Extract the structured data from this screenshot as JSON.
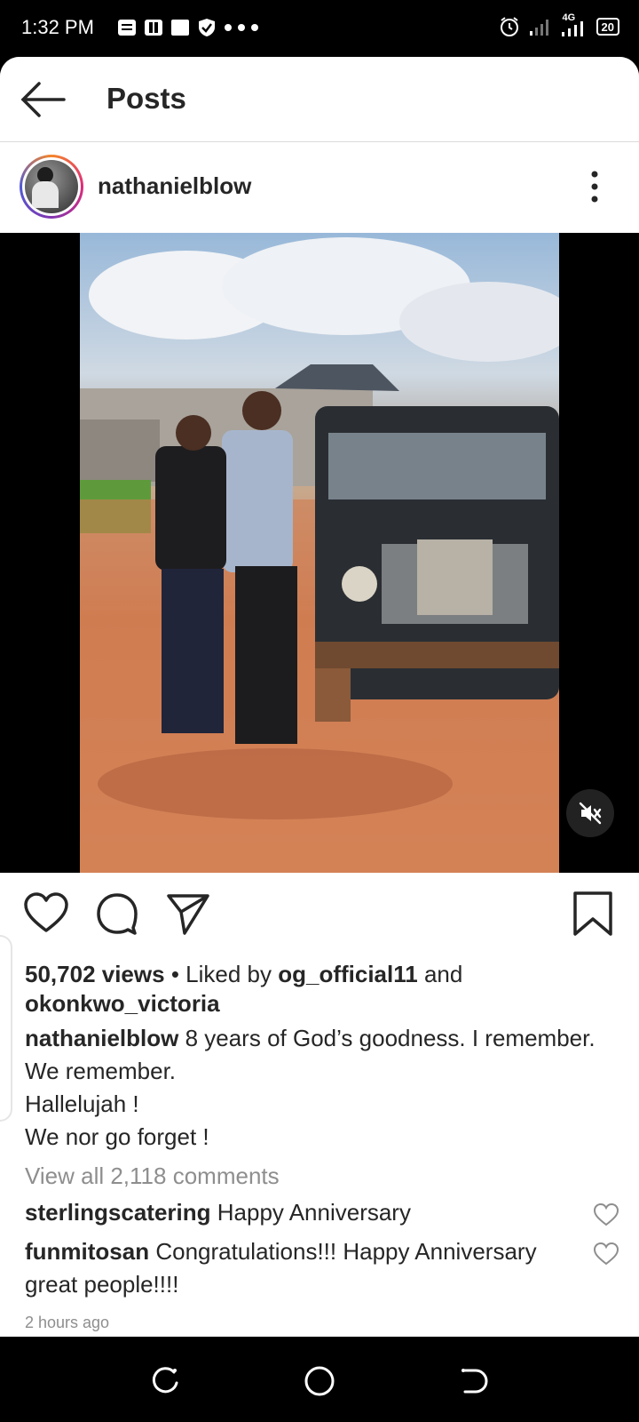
{
  "status_bar": {
    "time": "1:32 PM",
    "network": "4G",
    "battery": "20",
    "left_icons": [
      "message-icon",
      "portal-icon",
      "square-icon",
      "shield-icon",
      "more-dots-icon"
    ],
    "right_icons": [
      "alarm-icon",
      "signal-icon",
      "signal-4g-icon",
      "battery-icon"
    ]
  },
  "header": {
    "title": "Posts",
    "back_icon": "arrow-left-icon"
  },
  "post": {
    "username": "nathanielblow",
    "more_icon": "vertical-dots-icon",
    "media_type": "video",
    "mute_icon": "volume-muted-icon",
    "actions": [
      "heart-icon",
      "comment-icon",
      "share-icon",
      "bookmark-icon"
    ],
    "stats": {
      "views": "50,702 views",
      "liked_by_prefix": "• Liked by",
      "liked_user_1": "og_official11",
      "and": "and",
      "liked_user_2": "okonkwo_victoria"
    },
    "caption": {
      "author": "nathanielblow",
      "line1": "8 years of God’s goodness. I remember. We remember.",
      "line2": "Hallelujah !",
      "line3": "We nor go forget !"
    },
    "view_all_comments": "View all 2,118 comments",
    "comments": [
      {
        "user": "sterlingscatering",
        "text": "Happy Anniversary"
      },
      {
        "user": "funmitosan",
        "text": "Congratulations!!! Happy Anniversary great people!!!!"
      }
    ],
    "timestamp": "2 hours ago"
  },
  "nav_bar": [
    "recent-apps-icon",
    "home-icon",
    "back-icon"
  ]
}
